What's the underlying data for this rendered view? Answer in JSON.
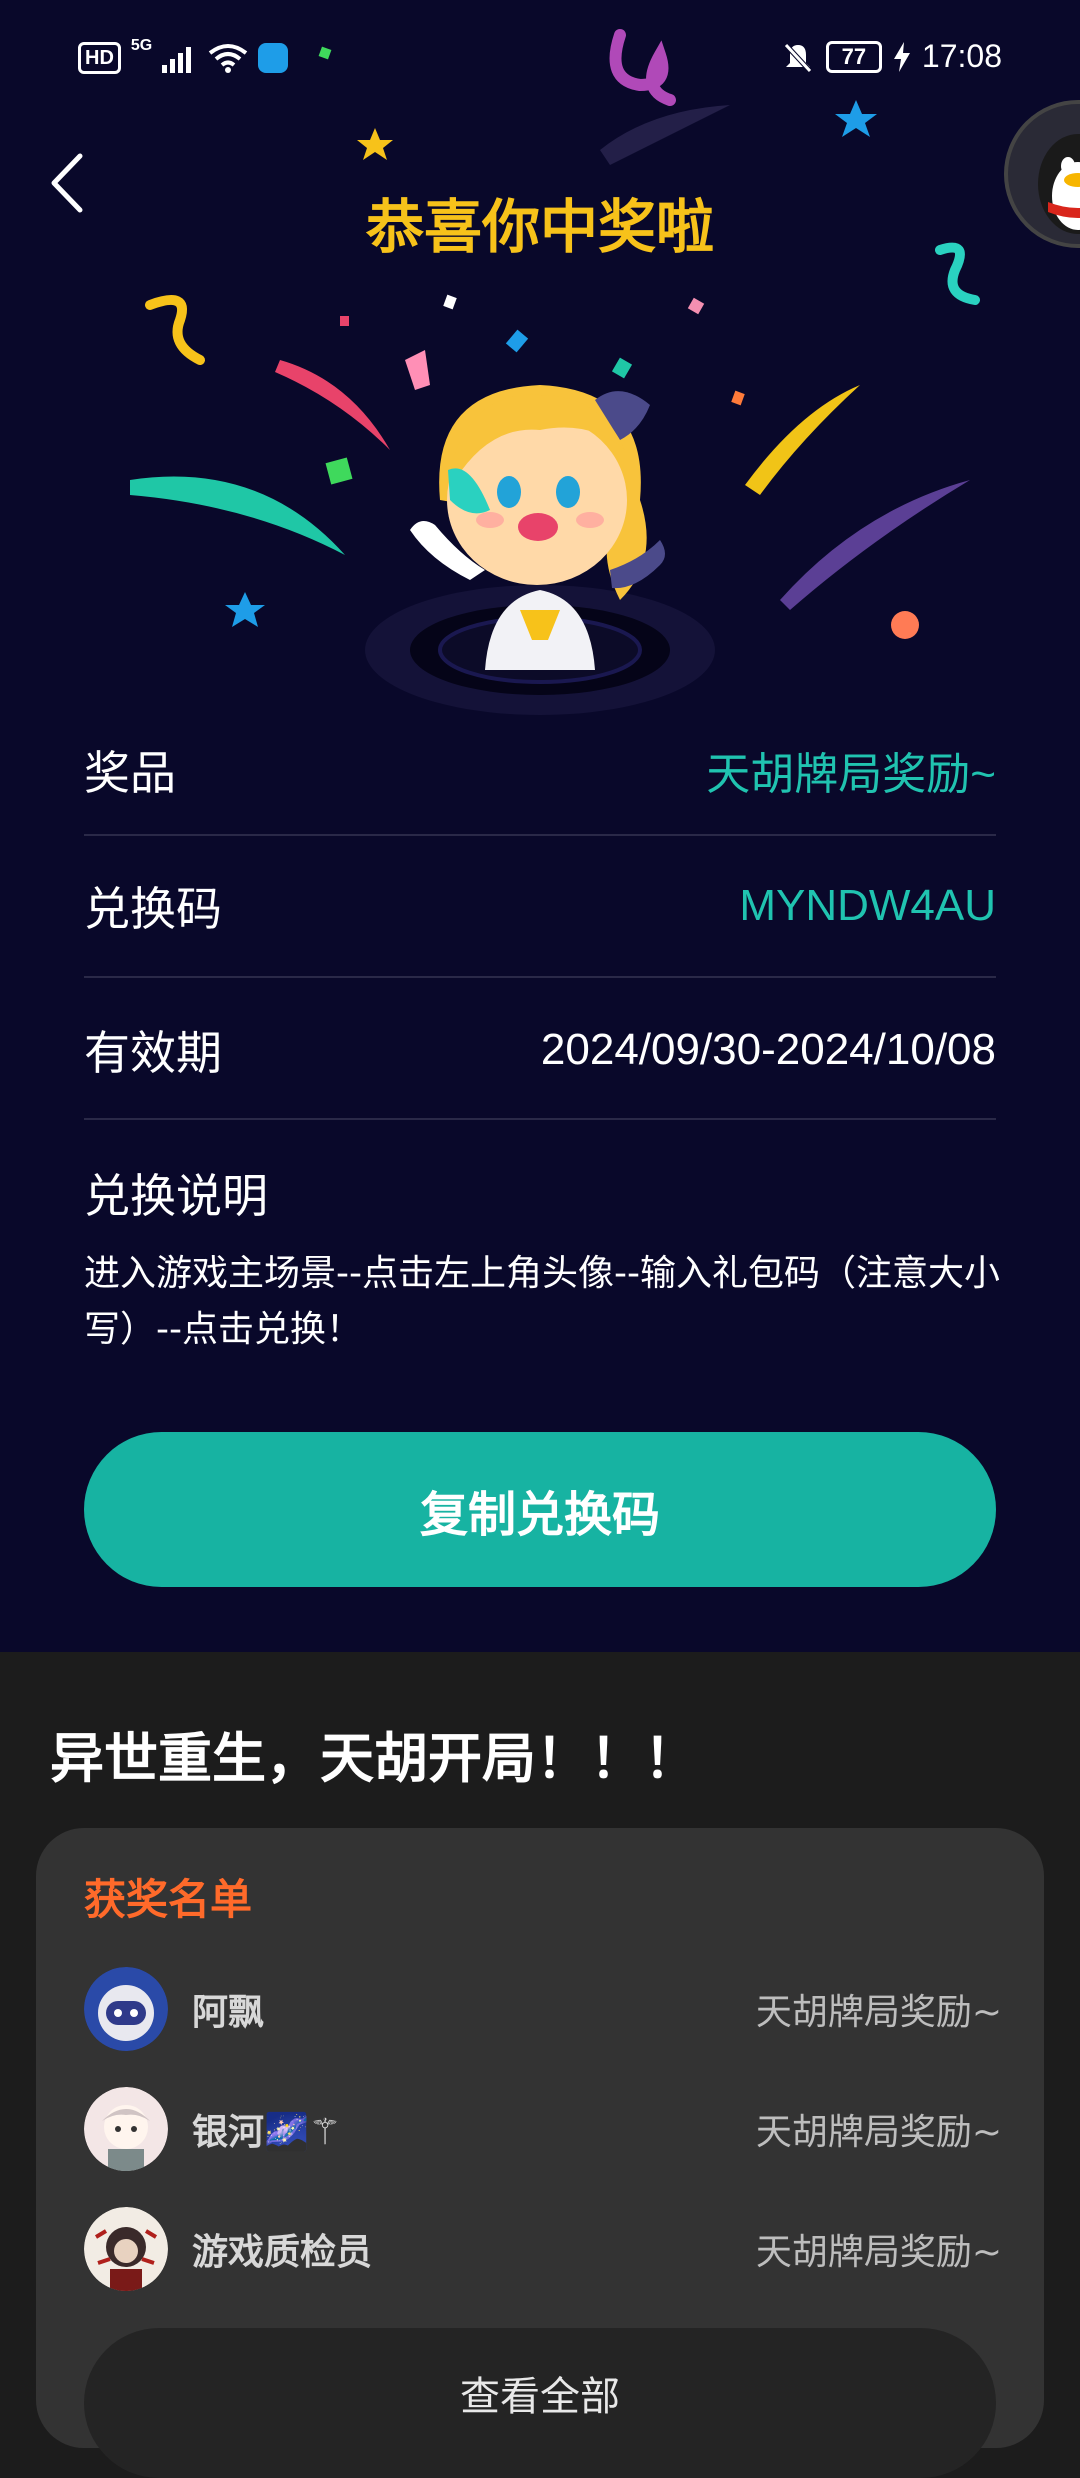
{
  "status_bar": {
    "network_badge": "HD",
    "signal_gen": "5G",
    "battery": "77",
    "time": "17:08"
  },
  "header": {
    "title": "恭喜你中奖啦"
  },
  "details": {
    "prize_label": "奖品",
    "prize_value": "天胡牌局奖励~",
    "code_label": "兑换码",
    "code_value": "MYNDW4AU",
    "validity_label": "有效期",
    "validity_value": "2024/09/30-2024/10/08",
    "instructions_label": "兑换说明",
    "instructions_text": "进入游戏主场景--点击左上角头像--输入礼包码（注意大小写）--点击兑换！"
  },
  "actions": {
    "copy_label": "复制兑换码"
  },
  "promo": {
    "headline": "异世重生，天胡开局！！！"
  },
  "winners": {
    "title": "获奖名单",
    "items": [
      {
        "name": "阿飘",
        "prize": "天胡牌局奖励~"
      },
      {
        "name": "银河🌌⚚",
        "prize": "天胡牌局奖励~"
      },
      {
        "name": "游戏质检员",
        "prize": "天胡牌局奖励~"
      }
    ],
    "view_all_label": "查看全部"
  },
  "colors": {
    "accent_teal": "#17b3a2",
    "title_gold": "#f7c21a",
    "list_title_orange": "#ff6a2a",
    "top_bg": "#09082a"
  }
}
